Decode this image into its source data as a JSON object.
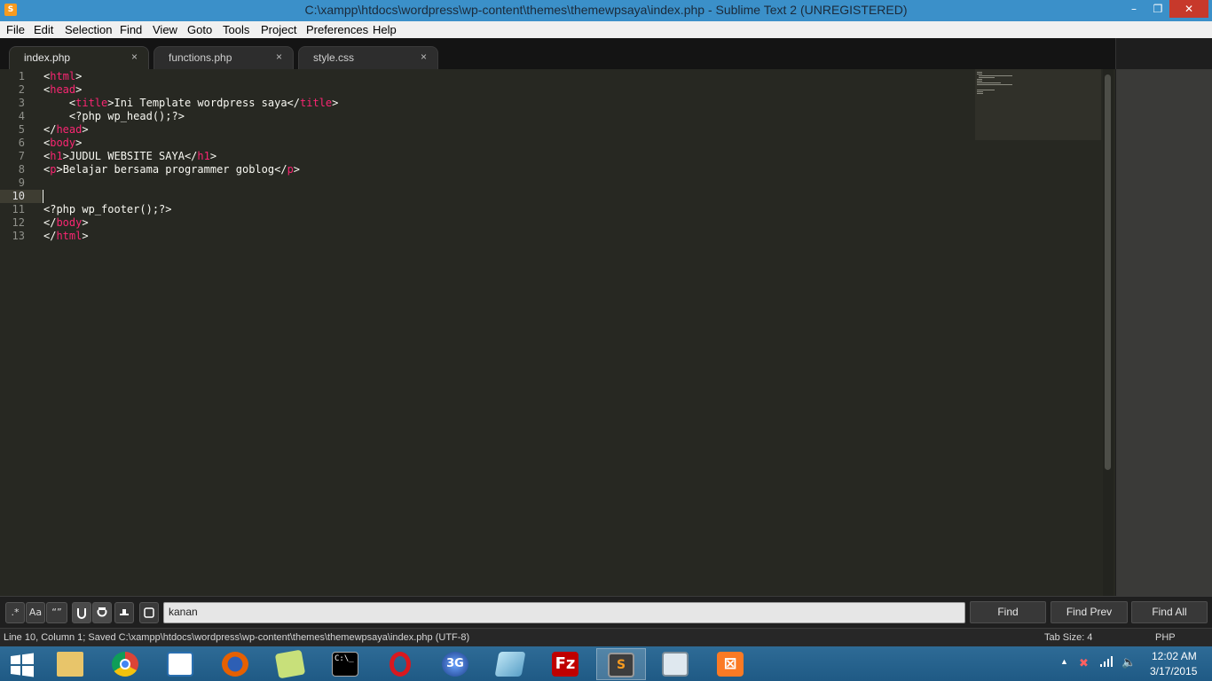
{
  "window": {
    "title": "C:\\xampp\\htdocs\\wordpress\\wp-content\\themes\\themewpsaya\\index.php - Sublime Text 2 (UNREGISTERED)",
    "controls": {
      "minimize": "–",
      "maximize": "❐",
      "close": "✕"
    }
  },
  "menu": [
    "File",
    "Edit",
    "Selection",
    "Find",
    "View",
    "Goto",
    "Tools",
    "Project",
    "Preferences",
    "Help"
  ],
  "tabs": [
    {
      "label": "index.php",
      "close": "×",
      "active": true
    },
    {
      "label": "functions.php",
      "close": "×",
      "active": false
    },
    {
      "label": "style.css",
      "close": "×",
      "active": false
    }
  ],
  "editor": {
    "current_line": 10,
    "lines": [
      {
        "n": "1",
        "parts": [
          {
            "t": "<"
          },
          {
            "t": "html",
            "tag": true
          },
          {
            "t": ">"
          }
        ]
      },
      {
        "n": "2",
        "parts": [
          {
            "t": "<"
          },
          {
            "t": "head",
            "tag": true
          },
          {
            "t": ">"
          }
        ]
      },
      {
        "n": "3",
        "parts": [
          {
            "t": "    <"
          },
          {
            "t": "title",
            "tag": true
          },
          {
            "t": ">Ini Template wordpress saya</"
          },
          {
            "t": "title",
            "tag": true
          },
          {
            "t": ">"
          }
        ]
      },
      {
        "n": "4",
        "parts": [
          {
            "t": "    <?php wp_head();?>"
          }
        ]
      },
      {
        "n": "5",
        "parts": [
          {
            "t": "</"
          },
          {
            "t": "head",
            "tag": true
          },
          {
            "t": ">"
          }
        ]
      },
      {
        "n": "6",
        "parts": [
          {
            "t": "<"
          },
          {
            "t": "body",
            "tag": true
          },
          {
            "t": ">"
          }
        ]
      },
      {
        "n": "7",
        "parts": [
          {
            "t": "<"
          },
          {
            "t": "h1",
            "tag": true
          },
          {
            "t": ">JUDUL WEBSITE SAYA</"
          },
          {
            "t": "h1",
            "tag": true
          },
          {
            "t": ">"
          }
        ]
      },
      {
        "n": "8",
        "parts": [
          {
            "t": "<"
          },
          {
            "t": "p",
            "tag": true
          },
          {
            "t": ">Belajar bersama programmer goblog</"
          },
          {
            "t": "p",
            "tag": true
          },
          {
            "t": ">"
          }
        ]
      },
      {
        "n": "9",
        "parts": []
      },
      {
        "n": "10",
        "parts": []
      },
      {
        "n": "11",
        "parts": [
          {
            "t": "<?php wp_footer();?>"
          }
        ]
      },
      {
        "n": "12",
        "parts": [
          {
            "t": "</"
          },
          {
            "t": "body",
            "tag": true
          },
          {
            "t": ">"
          }
        ]
      },
      {
        "n": "13",
        "parts": [
          {
            "t": "</"
          },
          {
            "t": "html",
            "tag": true
          },
          {
            "t": ">"
          }
        ]
      }
    ]
  },
  "findbar": {
    "toggles": [
      ".*",
      "Aa",
      "“”"
    ],
    "option_icons": [
      "wrap-icon",
      "in-selection-icon",
      "highlight-icon",
      "box-icon"
    ],
    "query": "kanan",
    "buttons": [
      "Find",
      "Find Prev",
      "Find All"
    ]
  },
  "status": {
    "left": "Line 10, Column 1; Saved C:\\xampp\\htdocs\\wordpress\\wp-content\\themes\\themewpsaya\\index.php (UTF-8)",
    "tab_size": "Tab Size: 4",
    "syntax": "PHP"
  },
  "taskbar": {
    "apps": [
      "windows-start",
      "file-explorer",
      "chrome",
      "notepad-window",
      "firefox",
      "sticky-notes",
      "command-prompt",
      "opera",
      "3g-modem",
      "notebook-app",
      "filezilla",
      "sublime-text",
      "resource-monitor",
      "xampp"
    ],
    "clock": {
      "time": "12:02 AM",
      "date": "3/17/2015"
    }
  },
  "colors": {
    "editor_bg": "#272822",
    "tag": "#f92672",
    "titlebar": "#3b90c9",
    "taskbar": "#1f5a85"
  }
}
